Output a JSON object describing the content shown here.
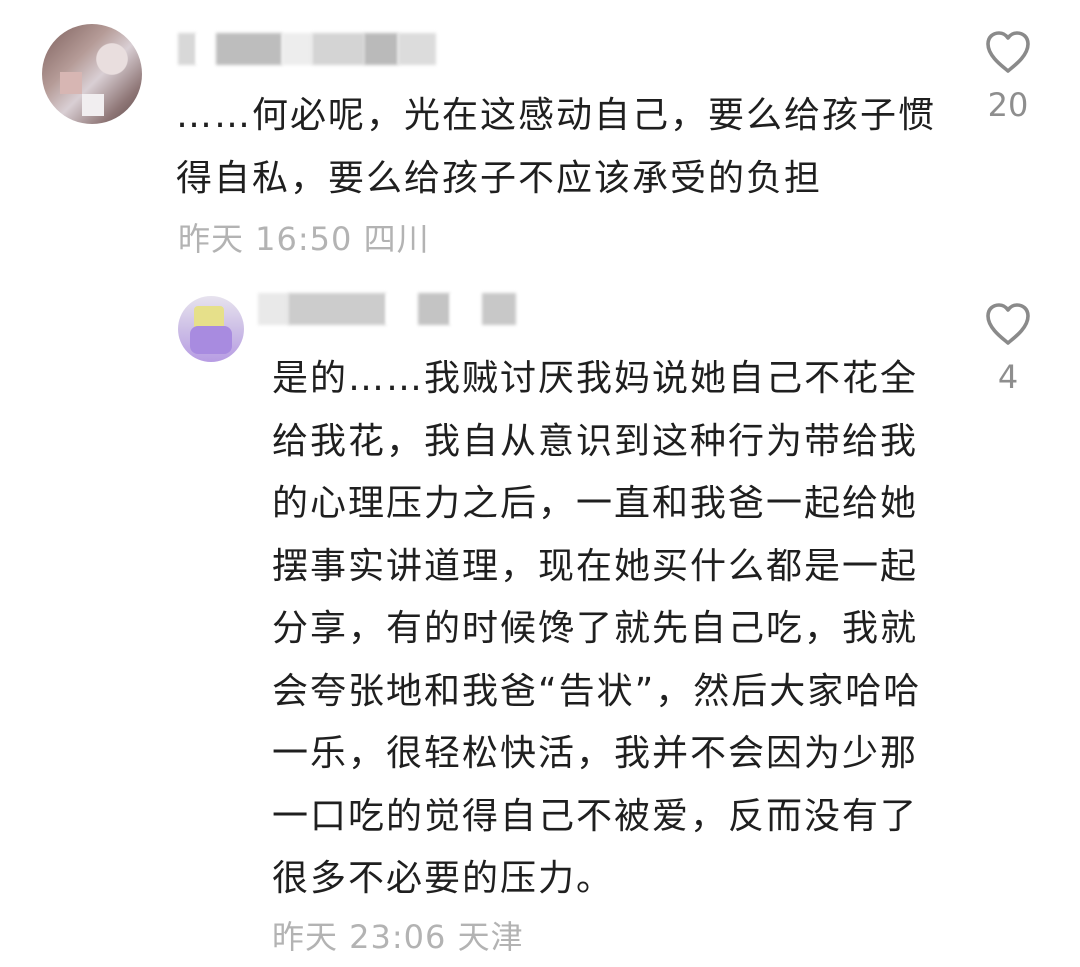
{
  "comments": [
    {
      "text": "……何必呢，光在这感动自己，要么给孩子惯得自私，要么给孩子不应该承受的负担",
      "time": "昨天 16:50",
      "location": "四川",
      "meta": "昨天 16:50 四川",
      "likes": "20"
    },
    {
      "text": "是的……我贼讨厌我妈说她自己不花全给我花，我自从意识到这种行为带给我的心理压力之后，一直和我爸一起给她摆事实讲道理，现在她买什么都是一起分享，有的时候馋了就先自己吃，我就会夸张地和我爸“告状”，然后大家哈哈一乐，很轻松快活，我并不会因为少那一口吃的觉得自己不被爱，反而没有了很多不必要的压力。",
      "time": "昨天 23:06",
      "location": "天津",
      "meta": "昨天 23:06 天津",
      "likes": "4"
    }
  ],
  "icons": {
    "like": "heart-outline-icon"
  },
  "colors": {
    "text": "#1f1f1f",
    "meta": "#b3b3b3",
    "like_count": "#8e8e8e",
    "heart_stroke": "#8a8a8a"
  }
}
